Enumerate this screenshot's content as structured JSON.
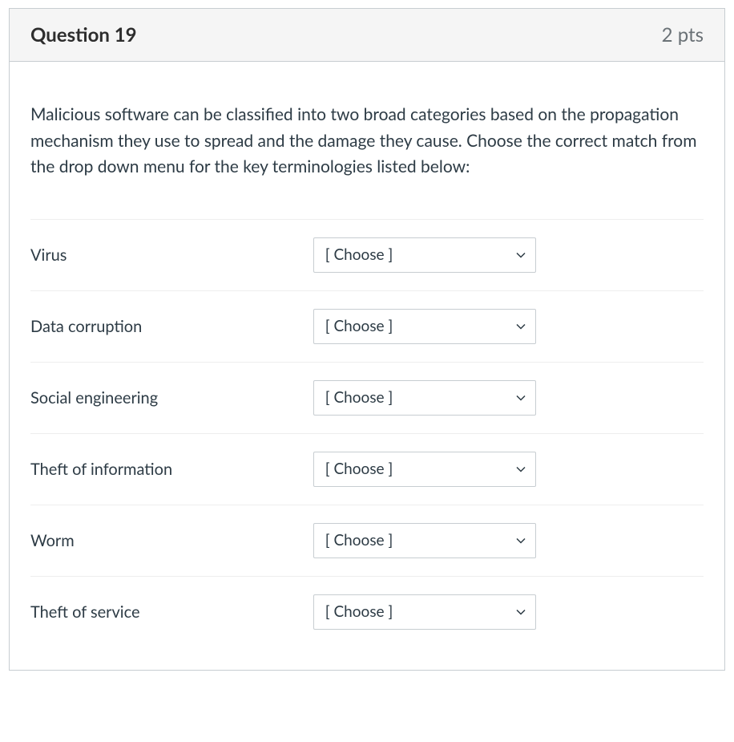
{
  "header": {
    "title": "Question 19",
    "points": "2 pts"
  },
  "prompt": "Malicious software can be classified into two broad categories based on the propagation mechanism they use to spread and the damage they cause. Choose the correct match from the drop down menu for the key terminologies listed below:",
  "default_select_text": "[ Choose ]",
  "rows": [
    {
      "label": "Virus",
      "value": "[ Choose ]"
    },
    {
      "label": "Data corruption",
      "value": "[ Choose ]"
    },
    {
      "label": "Social engineering",
      "value": "[ Choose ]"
    },
    {
      "label": "Theft of information",
      "value": "[ Choose ]"
    },
    {
      "label": "Worm",
      "value": "[ Choose ]"
    },
    {
      "label": "Theft of service",
      "value": "[ Choose ]"
    }
  ]
}
